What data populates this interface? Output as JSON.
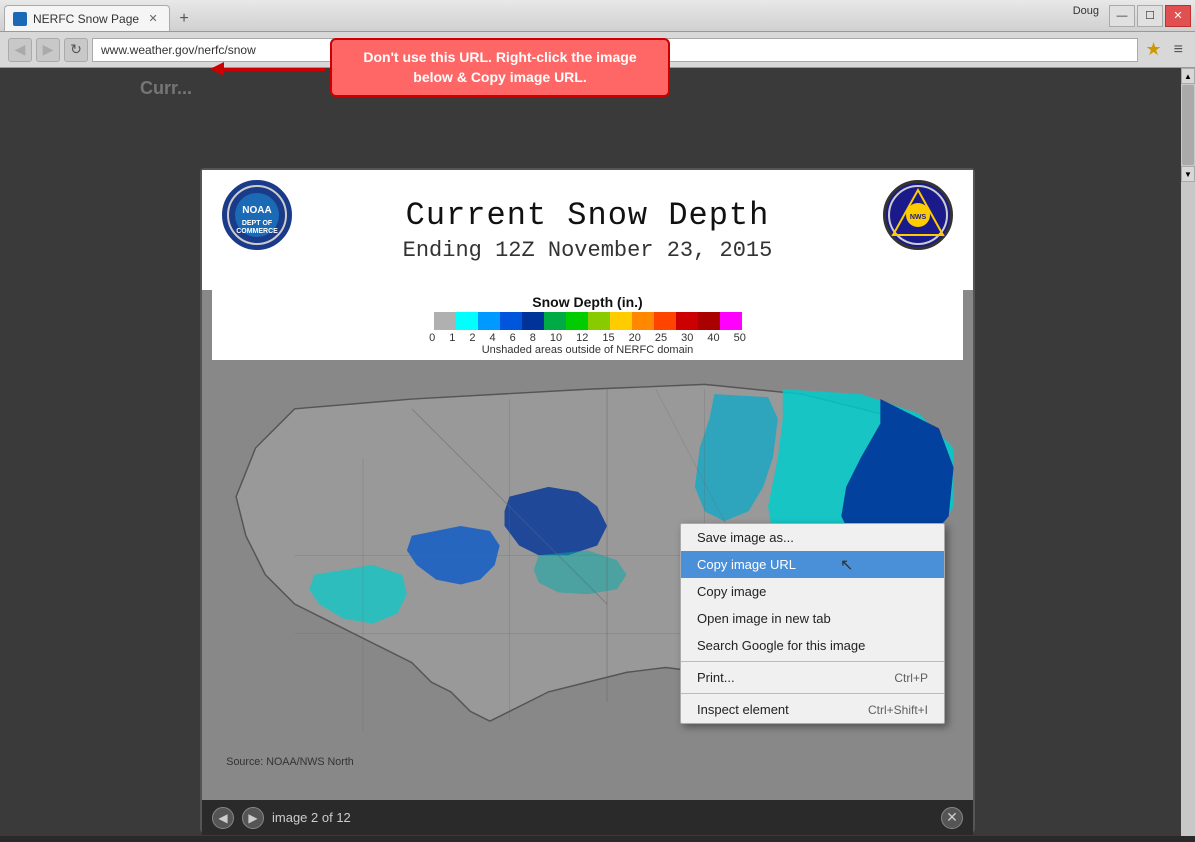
{
  "window": {
    "title": "NERFC Snow Page",
    "user": "Doug"
  },
  "address_bar": {
    "url": "www.weather.gov/nerfc/snow",
    "back_enabled": true,
    "forward_enabled": false
  },
  "callout": {
    "text": "Don't use this URL. Right-click the image below & Copy image URL."
  },
  "map": {
    "title": "Current Snow Depth",
    "subtitle": "Ending 12Z November 23, 2015",
    "legend_title": "Snow Depth (in.)",
    "legend_labels": [
      "0",
      "1",
      "2",
      "4",
      "6",
      "8",
      "10",
      "12",
      "15",
      "20",
      "25",
      "30",
      "40",
      "50"
    ],
    "legend_note": "Unshaded areas outside of NERFC domain",
    "source_text": "Source: NOAA/NWS North"
  },
  "image_nav": {
    "counter": "image 2 of 12",
    "prev_label": "◀",
    "next_label": "▶",
    "close_label": "✕"
  },
  "context_menu": {
    "items": [
      {
        "label": "Save image as...",
        "shortcut": "",
        "highlighted": false
      },
      {
        "label": "Copy image URL",
        "shortcut": "",
        "highlighted": true
      },
      {
        "label": "Copy image",
        "shortcut": "",
        "highlighted": false
      },
      {
        "label": "Open image in new tab",
        "shortcut": "",
        "highlighted": false
      },
      {
        "label": "Search Google for this image",
        "shortcut": "",
        "highlighted": false
      },
      {
        "label": "Print...",
        "shortcut": "Ctrl+P",
        "highlighted": false
      },
      {
        "label": "Inspect element",
        "shortcut": "Ctrl+Shift+I",
        "highlighted": false
      }
    ]
  },
  "legend_colors": [
    {
      "color": "#b0b0b0"
    },
    {
      "color": "#00ffff"
    },
    {
      "color": "#0099ff"
    },
    {
      "color": "#0055dd"
    },
    {
      "color": "#003399"
    },
    {
      "color": "#00aa44"
    },
    {
      "color": "#00cc00"
    },
    {
      "color": "#88cc00"
    },
    {
      "color": "#ffcc00"
    },
    {
      "color": "#ff8800"
    },
    {
      "color": "#ff4400"
    },
    {
      "color": "#cc0000"
    },
    {
      "color": "#aa0000"
    },
    {
      "color": "#ff00ff"
    }
  ]
}
